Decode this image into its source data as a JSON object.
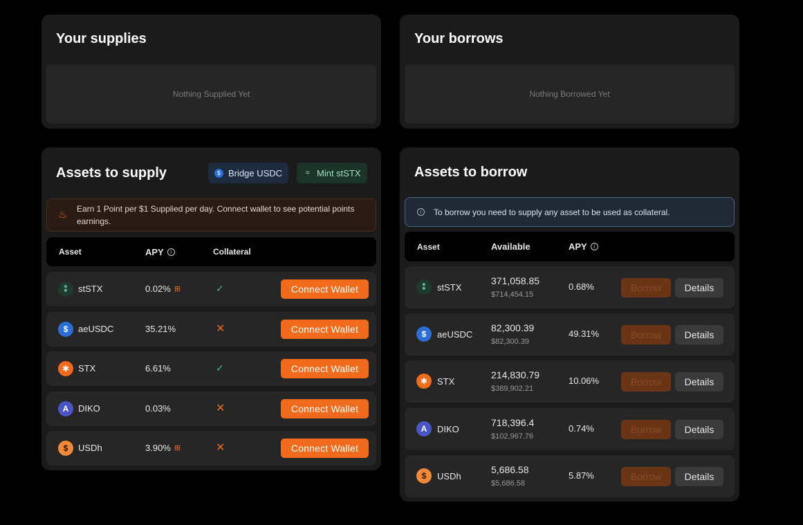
{
  "supplies": {
    "title": "Your supplies",
    "empty_text": "Nothing Supplied Yet"
  },
  "borrows": {
    "title": "Your borrows",
    "empty_text": "Nothing Borrowed Yet"
  },
  "assets_to_supply": {
    "title": "Assets to supply",
    "bridge_label": "Bridge USDC",
    "mint_label": "Mint stSTX",
    "banner": "Earn 1 Point per $1 Supplied per day. Connect wallet to see potential points earnings.",
    "columns": {
      "asset": "Asset",
      "apy": "APY",
      "collateral": "Collateral"
    },
    "button_label": "Connect Wallet",
    "rows": [
      {
        "symbol": "stSTX",
        "apy": "0.02%",
        "points": true,
        "collateral": true
      },
      {
        "symbol": "aeUSDC",
        "apy": "35.21%",
        "points": false,
        "collateral": false
      },
      {
        "symbol": "STX",
        "apy": "6.61%",
        "points": false,
        "collateral": true
      },
      {
        "symbol": "DIKO",
        "apy": "0.03%",
        "points": false,
        "collateral": false
      },
      {
        "symbol": "USDh",
        "apy": "3.90%",
        "points": true,
        "collateral": false
      }
    ]
  },
  "assets_to_borrow": {
    "title": "Assets to borrow",
    "banner": "To borrow you need to supply any asset to be used as collateral.",
    "columns": {
      "asset": "Asset",
      "available": "Available",
      "apy": "APY"
    },
    "borrow_label": "Borrow",
    "details_label": "Details",
    "rows": [
      {
        "symbol": "stSTX",
        "available": "371,058.85",
        "usd": "$714,454.15",
        "apy": "0.68%"
      },
      {
        "symbol": "aeUSDC",
        "available": "82,300.39",
        "usd": "$82,300.39",
        "apy": "49.31%"
      },
      {
        "symbol": "STX",
        "available": "214,830.79",
        "usd": "$389,902.21",
        "apy": "10.06%"
      },
      {
        "symbol": "DIKO",
        "available": "718,396.4",
        "usd": "$102,967.76",
        "apy": "0.74%"
      },
      {
        "symbol": "USDh",
        "available": "5,686.58",
        "usd": "$5,686.58",
        "apy": "5.87%"
      }
    ]
  },
  "icons": {
    "stSTX": {
      "glyph": "⁑",
      "bg": "#1f3a2e",
      "fg": "#7fe0b4"
    },
    "aeUSDC": {
      "glyph": "$",
      "bg": "#2b6fd6",
      "fg": "#ffffff"
    },
    "STX": {
      "glyph": "✱",
      "bg": "#f26a1b",
      "fg": "#ffffff"
    },
    "DIKO": {
      "glyph": "A",
      "bg": "#4a56c8",
      "fg": "#ffffff"
    },
    "USDh": {
      "glyph": "$",
      "bg": "#f08a3a",
      "fg": "#2a1405"
    }
  },
  "colors": {
    "accent": "#f26a1b",
    "panel": "#1b1b1b",
    "row": "#262626",
    "success": "#3fbf7f"
  }
}
